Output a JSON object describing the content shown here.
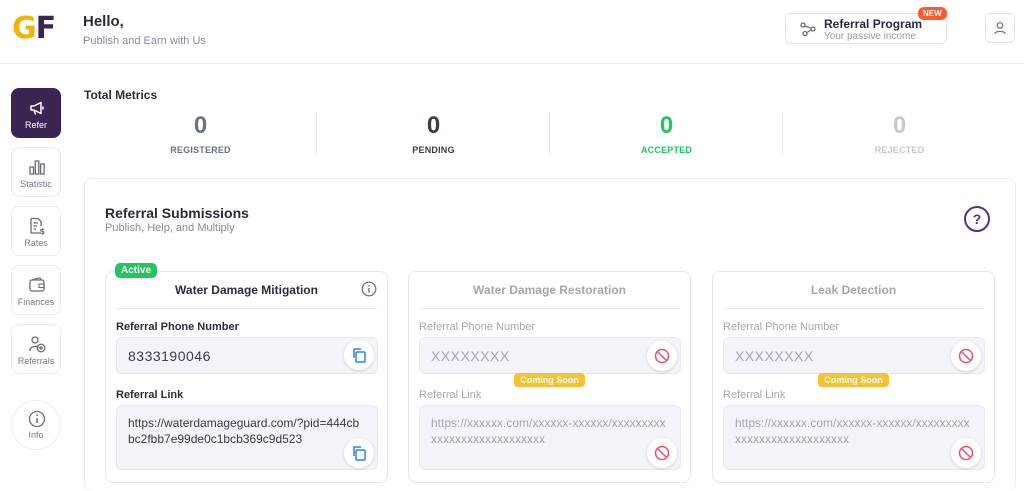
{
  "header": {
    "logo": {
      "g": "G",
      "f": "F"
    },
    "greeting": "Hello,",
    "subtitle": "Publish and Earn with Us",
    "referral_program": {
      "title": "Referral Program",
      "subtitle": "Your passive income",
      "badge": "NEW"
    }
  },
  "sidebar": {
    "items": [
      {
        "label": "Refer",
        "icon": "megaphone-icon",
        "active": true
      },
      {
        "label": "Statistic",
        "icon": "bar-chart-icon"
      },
      {
        "label": "Rates",
        "icon": "document-dollar-icon"
      },
      {
        "label": "Finances",
        "icon": "wallet-icon"
      },
      {
        "label": "Referrals",
        "icon": "user-plus-icon"
      }
    ],
    "info_label": "Info"
  },
  "metrics": {
    "title": "Total Metrics",
    "items": [
      {
        "value": "0",
        "label": "REGISTERED",
        "color": "#6b7287"
      },
      {
        "value": "0",
        "label": "PENDING",
        "color": "#3d3d4a"
      },
      {
        "value": "0",
        "label": "ACCEPTED",
        "color": "#22c55e"
      },
      {
        "value": "0",
        "label": "REJECTED",
        "color": "#c5c8d6"
      }
    ]
  },
  "submissions": {
    "title": "Referral Submissions",
    "subtitle": "Publish, Help, and Multiply",
    "help": "?",
    "cards": [
      {
        "title": "Water Damage Mitigation",
        "badge": "Active",
        "phone_label": "Referral Phone Number",
        "phone": "8333190046",
        "link_label": "Referral Link",
        "link": "https://waterdamageguard.com/?pid=444cbbc2fbb7e99de0c1bcb369c9d523"
      },
      {
        "title": "Water Damage Restoration",
        "phone_label": "Referral Phone Number",
        "phone": "XXXXXXXX",
        "coming_soon": "Coming Soon",
        "link_label": "Referral Link",
        "link": "https://xxxxxx.com/xxxxxx-xxxxxx/xxxxxxxxxxxxxxxxxxxxxxxxxxxx"
      },
      {
        "title": "Leak Detection",
        "phone_label": "Referral Phone Number",
        "phone": "XXXXXXXX",
        "coming_soon": "Coming Soon",
        "link_label": "Referral Link",
        "link": "https://xxxxxx.com/xxxxxx-xxxxxx/xxxxxxxxxxxxxxxxxxxxxxxxxxxx"
      }
    ]
  }
}
